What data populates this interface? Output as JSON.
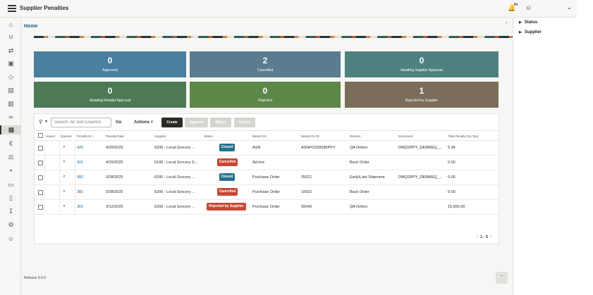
{
  "app": {
    "title": "Supplier Penalties",
    "notification_count": "9+"
  },
  "breadcrumb": {
    "home": "Home"
  },
  "tiles": [
    {
      "value": "0",
      "label": "Approved",
      "color": "#4b7f9f"
    },
    {
      "value": "2",
      "label": "Cancelled",
      "color": "#5a7c8e"
    },
    {
      "value": "0",
      "label": "Awaiting Supplier Approval",
      "color": "#4f8180"
    },
    {
      "value": "0",
      "label": "Awaiting Retailer Approval",
      "color": "#4d7a55"
    },
    {
      "value": "0",
      "label": "Rejected",
      "color": "#5d8649"
    },
    {
      "value": "1",
      "label": "Rejected by Supplier",
      "color": "#7a6e5a"
    }
  ],
  "toolbar": {
    "search_placeholder": "Search: All Text Columns",
    "go": "Go",
    "actions": "Actions",
    "create": "Create",
    "approve": "Approve",
    "reject": "Reject",
    "cancel": "Cancel"
  },
  "table": {
    "headers": [
      "Issues",
      "Queries",
      "Penalty ID",
      "Penalty Date",
      "Supplier",
      "Status",
      "Based On",
      "Based On ID",
      "Reason",
      "Document",
      "Total Penalty (Ex Tax)"
    ],
    "rows": [
      {
        "id": "425",
        "date": "4/29/2025",
        "supplier": "6200 - Local Grocery ...",
        "status": "Closed",
        "based_on": "ASN",
        "based_on_id": "ASNPO250085PPY",
        "reason": "QA Defect",
        "document": "DMQSPPY_DEBMEQ_...",
        "total": "5.94"
      },
      {
        "id": "421",
        "date": "4/29/2025",
        "supplier": "6100 - Local Grocery S...",
        "status": "Cancelled",
        "based_on": "Ad-hoc",
        "based_on_id": "",
        "reason": "Back Order",
        "document": "",
        "total": "0.00"
      },
      {
        "id": "382",
        "date": "3/28/2025",
        "supplier": "6200 - Local Grocery ...",
        "status": "Closed",
        "based_on": "Purchase Order",
        "based_on_id": "25021",
        "reason": "Early/Late Shipment",
        "document": "DMQSPPY_DEBMEQ_...",
        "total": "0.05"
      },
      {
        "id": "381",
        "date": "3/28/2025",
        "supplier": "6200 - Local Grocery ...",
        "status": "Cancelled",
        "based_on": "Purchase Order",
        "based_on_id": "10022",
        "reason": "Back Order",
        "document": "",
        "total": "0.00"
      },
      {
        "id": "361",
        "date": "3/12/2025",
        "supplier": "6200 - Local Grocery ...",
        "status": "Rejected by Supplier",
        "based_on": "Purchase Order",
        "based_on_id": "55040",
        "reason": "QA Defect",
        "document": "",
        "total": "15,660.00"
      }
    ]
  },
  "pagination": {
    "range": "1 - 5"
  },
  "footer": {
    "release": "Release 9.0.0"
  },
  "filters": {
    "status": "Status",
    "supplier": "Supplier"
  },
  "nav_icons": [
    "home-icon",
    "cart-icon",
    "returns-icon",
    "inbox-icon",
    "box-icon",
    "list-icon",
    "clipboard-icon",
    "handshake-icon",
    "penalties-icon",
    "euro-icon",
    "scale-icon",
    "truck-icon",
    "invoice-icon",
    "report-icon",
    "download-icon",
    "settings-icon",
    "person-icon"
  ]
}
